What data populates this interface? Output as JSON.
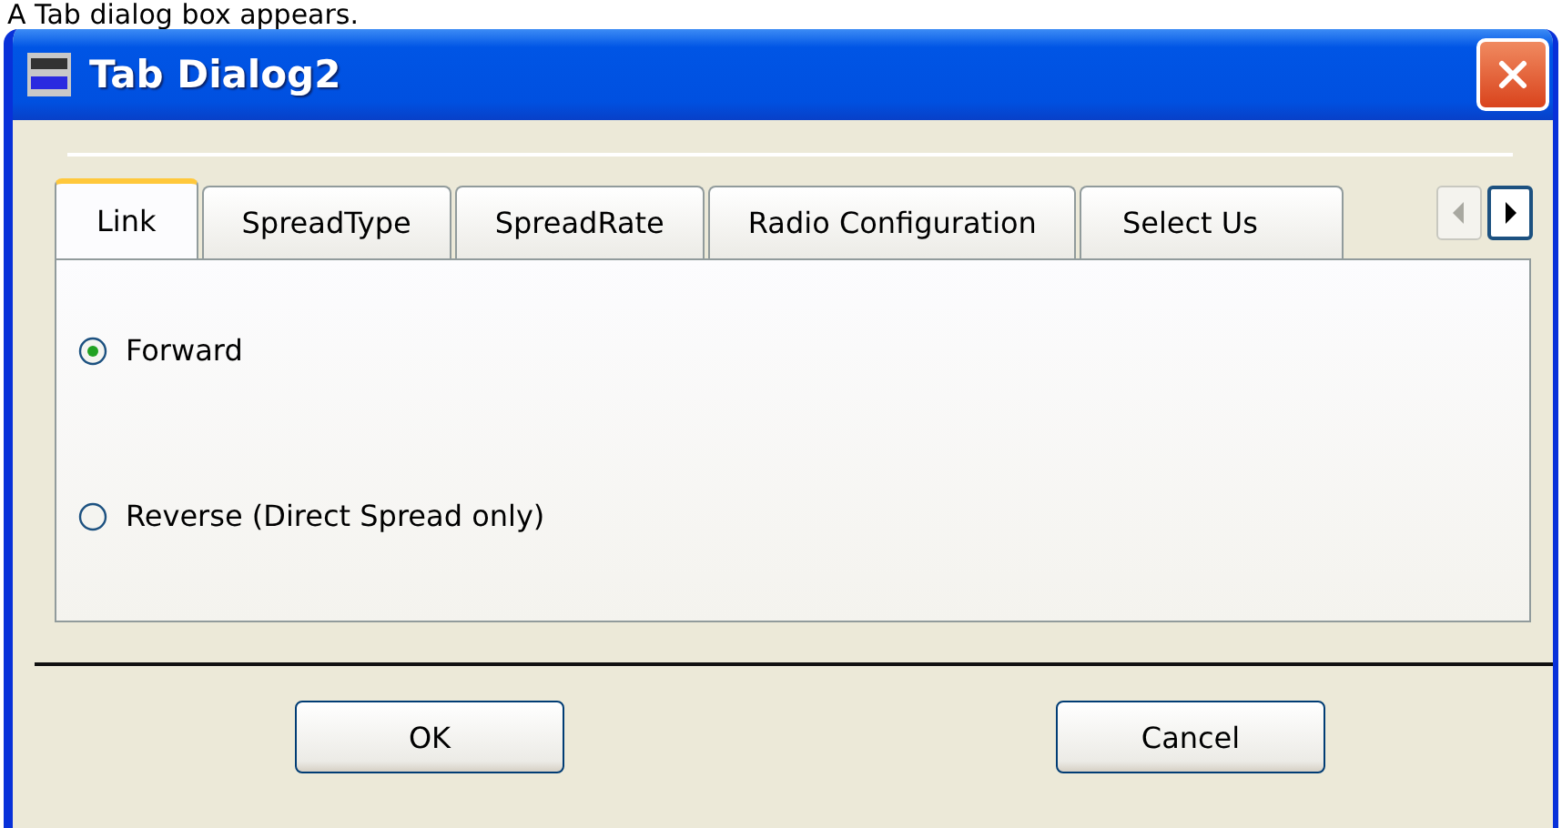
{
  "caption": "A Tab dialog box appears.",
  "window": {
    "title": "Tab Dialog2"
  },
  "tabs": [
    {
      "label": "Link",
      "selected": true
    },
    {
      "label": "SpreadType",
      "selected": false
    },
    {
      "label": "SpreadRate",
      "selected": false
    },
    {
      "label": "Radio Configuration",
      "selected": false
    },
    {
      "label": "Select Us",
      "selected": false
    }
  ],
  "tab_scroll": [
    {
      "kind": "left",
      "disabled": true
    },
    {
      "kind": "right",
      "disabled": false
    }
  ],
  "options": [
    {
      "label": "Forward",
      "selected": true
    },
    {
      "label": "Reverse (Direct Spread only)",
      "selected": false
    }
  ],
  "buttons": [
    "OK",
    "Cancel"
  ]
}
